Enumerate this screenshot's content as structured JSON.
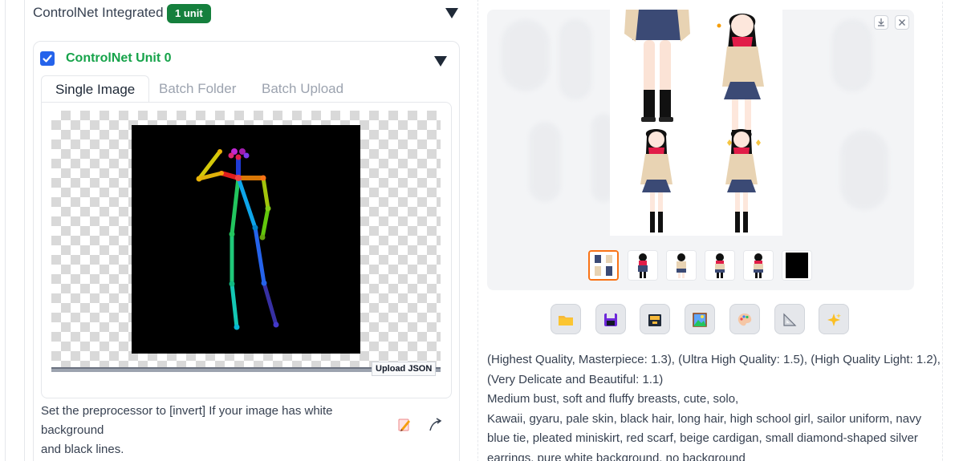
{
  "controlnet": {
    "title": "ControlNet Integrated",
    "units_badge": "1 unit",
    "unit": {
      "title": "ControlNet Unit 0",
      "enabled": true,
      "tabs": [
        {
          "label": "Single Image",
          "active": true
        },
        {
          "label": "Batch Folder",
          "active": false
        },
        {
          "label": "Batch Upload",
          "active": false
        }
      ],
      "upload_json_label": "Upload JSON",
      "hint_lines": [
        "Set the preprocessor to [invert] If your image has white background",
        "and black lines."
      ]
    }
  },
  "output": {
    "gallery": {
      "thumbnail_count": 6,
      "selected_thumbnail": 0
    },
    "tools": [
      "folder-icon",
      "save-icon",
      "zip-icon",
      "image-icon",
      "palette-icon",
      "ruler-icon",
      "sparkle-icon"
    ],
    "prompt_lines": [
      "(Highest Quality, Masterpiece: 1.3), (Ultra High Quality: 1.5), (High Quality Light: 1.2),",
      "(Very Delicate and Beautiful: 1.1)",
      "Medium bust, soft and fluffy breasts, cute, solo,",
      "Kawaii, gyaru, pale skin, black hair, long hair, high school girl, sailor uniform, navy",
      "blue tie, pleated miniskirt, red scarf, beige cardigan, small diamond-shaped silver",
      "earrings, pure white background, no background"
    ]
  },
  "colors": {
    "accent_green": "#16a34a",
    "badge_green": "#15803d",
    "checkbox_blue": "#2563eb",
    "thumb_selected": "#f97316"
  }
}
